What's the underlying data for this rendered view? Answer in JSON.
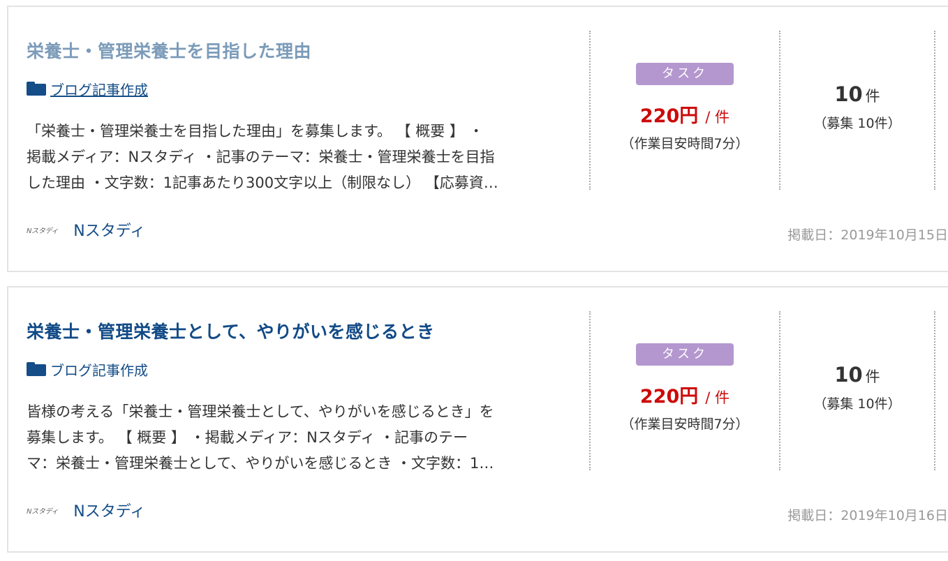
{
  "jobs": [
    {
      "title": "栄養士・管理栄養士を目指した理由",
      "category": "ブログ記事作成",
      "description_lines": [
        "「栄養士・管理栄養士を目指した理由」を募集します。 【 概要 】 ・",
        "掲載メディア：Nスタディ ・記事のテーマ：栄養士・管理栄養士を目指",
        "した理由 ・文字数：1記事あたり300文字以上（制限なし） 【応募資…"
      ],
      "client_logo": "Nスタディ",
      "client_name": "Nスタディ",
      "badge": "タスク",
      "price": "220円",
      "price_unit": "/ 件",
      "estimate": "（作業目安時間7分）",
      "count": "10",
      "count_unit": "件",
      "recruit": "（募集 10件）",
      "posted": "掲載日：2019年10月15日"
    },
    {
      "title": "栄養士・管理栄養士として、やりがいを感じるとき",
      "category": "ブログ記事作成",
      "description_lines": [
        "皆様の考える「栄養士・管理栄養士として、やりがいを感じるとき」を",
        "募集します。 【 概要 】 ・掲載メディア：Nスタディ ・記事のテー",
        "マ：栄養士・管理栄養士として、やりがいを感じるとき ・文字数：1…"
      ],
      "client_logo": "Nスタディ",
      "client_name": "Nスタディ",
      "badge": "タスク",
      "price": "220円",
      "price_unit": "/ 件",
      "estimate": "（作業目安時間7分）",
      "count": "10",
      "count_unit": "件",
      "recruit": "（募集 10件）",
      "posted": "掲載日：2019年10月16日"
    }
  ],
  "colors": {
    "title_visited": "#7b9bb9",
    "title_link": "#114a86",
    "price": "#cc0a0a",
    "badge_bg": "#b497cf"
  }
}
